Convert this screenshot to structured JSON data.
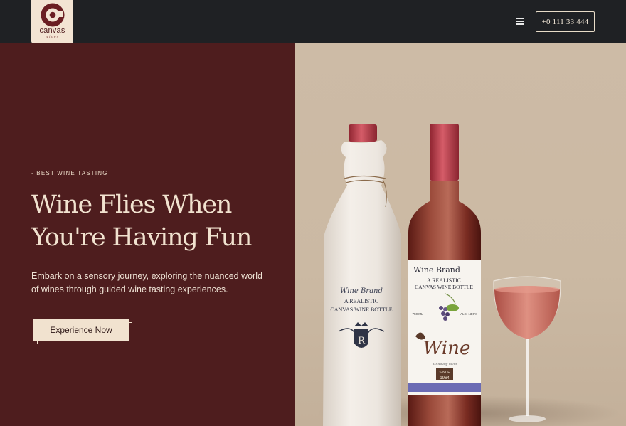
{
  "header": {
    "logo": {
      "brand": "canvas",
      "sub": "wines"
    },
    "phone_label": "+0 111 33 444"
  },
  "hero": {
    "eyebrow": "- BEST WINE TASTING",
    "headline_line1": "Wine Flies When",
    "headline_line2": "You're Having Fun",
    "description_line1": "Embark on a sensory journey, exploring the nuanced world",
    "description_line2": "of wines through guided wine tasting experiences.",
    "cta_label": "Experience Now"
  },
  "product": {
    "wrapped_bottle": {
      "brand": "Wine Brand",
      "tagline_line1": "A REALISTIC",
      "tagline_line2": "CANVAS WINE BOTTLE",
      "crest_letter": "R"
    },
    "labeled_bottle": {
      "brand": "Wine Brand",
      "tagline_line1": "A REALISTIC",
      "tagline_line2": "CANVAS WINE BOTTLE",
      "volume": "750 ML",
      "abv": "ALC. 13,5%",
      "script_word": "Wine",
      "subline": "company name",
      "since": "SINCE",
      "year": "1964"
    }
  },
  "colors": {
    "header_bg": "#1f2124",
    "left_panel": "#4e1d1e",
    "right_panel": "#cdbba6",
    "cream": "#f1e2cf",
    "wine": "#a5343a"
  }
}
